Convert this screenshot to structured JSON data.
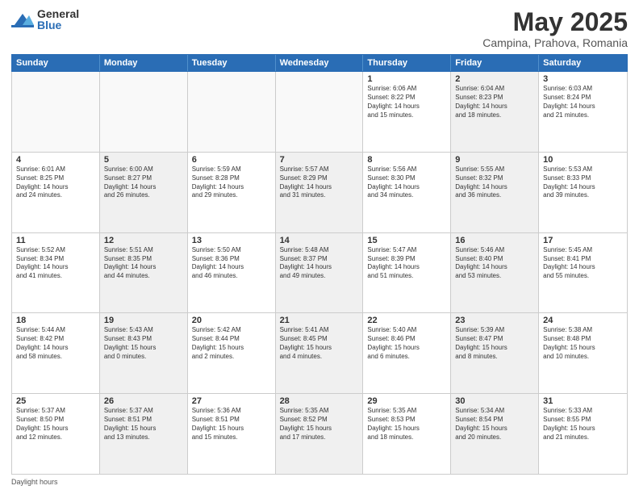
{
  "logo": {
    "general": "General",
    "blue": "Blue"
  },
  "title": "May 2025",
  "subtitle": "Campina, Prahova, Romania",
  "days": [
    "Sunday",
    "Monday",
    "Tuesday",
    "Wednesday",
    "Thursday",
    "Friday",
    "Saturday"
  ],
  "weeks": [
    [
      {
        "num": "",
        "text": "",
        "empty": true
      },
      {
        "num": "",
        "text": "",
        "empty": true
      },
      {
        "num": "",
        "text": "",
        "empty": true
      },
      {
        "num": "",
        "text": "",
        "empty": true
      },
      {
        "num": "1",
        "text": "Sunrise: 6:06 AM\nSunset: 8:22 PM\nDaylight: 14 hours\nand 15 minutes.",
        "empty": false
      },
      {
        "num": "2",
        "text": "Sunrise: 6:04 AM\nSunset: 8:23 PM\nDaylight: 14 hours\nand 18 minutes.",
        "empty": false,
        "shaded": true
      },
      {
        "num": "3",
        "text": "Sunrise: 6:03 AM\nSunset: 8:24 PM\nDaylight: 14 hours\nand 21 minutes.",
        "empty": false
      }
    ],
    [
      {
        "num": "4",
        "text": "Sunrise: 6:01 AM\nSunset: 8:25 PM\nDaylight: 14 hours\nand 24 minutes.",
        "empty": false
      },
      {
        "num": "5",
        "text": "Sunrise: 6:00 AM\nSunset: 8:27 PM\nDaylight: 14 hours\nand 26 minutes.",
        "empty": false,
        "shaded": true
      },
      {
        "num": "6",
        "text": "Sunrise: 5:59 AM\nSunset: 8:28 PM\nDaylight: 14 hours\nand 29 minutes.",
        "empty": false
      },
      {
        "num": "7",
        "text": "Sunrise: 5:57 AM\nSunset: 8:29 PM\nDaylight: 14 hours\nand 31 minutes.",
        "empty": false,
        "shaded": true
      },
      {
        "num": "8",
        "text": "Sunrise: 5:56 AM\nSunset: 8:30 PM\nDaylight: 14 hours\nand 34 minutes.",
        "empty": false
      },
      {
        "num": "9",
        "text": "Sunrise: 5:55 AM\nSunset: 8:32 PM\nDaylight: 14 hours\nand 36 minutes.",
        "empty": false,
        "shaded": true
      },
      {
        "num": "10",
        "text": "Sunrise: 5:53 AM\nSunset: 8:33 PM\nDaylight: 14 hours\nand 39 minutes.",
        "empty": false
      }
    ],
    [
      {
        "num": "11",
        "text": "Sunrise: 5:52 AM\nSunset: 8:34 PM\nDaylight: 14 hours\nand 41 minutes.",
        "empty": false
      },
      {
        "num": "12",
        "text": "Sunrise: 5:51 AM\nSunset: 8:35 PM\nDaylight: 14 hours\nand 44 minutes.",
        "empty": false,
        "shaded": true
      },
      {
        "num": "13",
        "text": "Sunrise: 5:50 AM\nSunset: 8:36 PM\nDaylight: 14 hours\nand 46 minutes.",
        "empty": false
      },
      {
        "num": "14",
        "text": "Sunrise: 5:48 AM\nSunset: 8:37 PM\nDaylight: 14 hours\nand 49 minutes.",
        "empty": false,
        "shaded": true
      },
      {
        "num": "15",
        "text": "Sunrise: 5:47 AM\nSunset: 8:39 PM\nDaylight: 14 hours\nand 51 minutes.",
        "empty": false
      },
      {
        "num": "16",
        "text": "Sunrise: 5:46 AM\nSunset: 8:40 PM\nDaylight: 14 hours\nand 53 minutes.",
        "empty": false,
        "shaded": true
      },
      {
        "num": "17",
        "text": "Sunrise: 5:45 AM\nSunset: 8:41 PM\nDaylight: 14 hours\nand 55 minutes.",
        "empty": false
      }
    ],
    [
      {
        "num": "18",
        "text": "Sunrise: 5:44 AM\nSunset: 8:42 PM\nDaylight: 14 hours\nand 58 minutes.",
        "empty": false
      },
      {
        "num": "19",
        "text": "Sunrise: 5:43 AM\nSunset: 8:43 PM\nDaylight: 15 hours\nand 0 minutes.",
        "empty": false,
        "shaded": true
      },
      {
        "num": "20",
        "text": "Sunrise: 5:42 AM\nSunset: 8:44 PM\nDaylight: 15 hours\nand 2 minutes.",
        "empty": false
      },
      {
        "num": "21",
        "text": "Sunrise: 5:41 AM\nSunset: 8:45 PM\nDaylight: 15 hours\nand 4 minutes.",
        "empty": false,
        "shaded": true
      },
      {
        "num": "22",
        "text": "Sunrise: 5:40 AM\nSunset: 8:46 PM\nDaylight: 15 hours\nand 6 minutes.",
        "empty": false
      },
      {
        "num": "23",
        "text": "Sunrise: 5:39 AM\nSunset: 8:47 PM\nDaylight: 15 hours\nand 8 minutes.",
        "empty": false,
        "shaded": true
      },
      {
        "num": "24",
        "text": "Sunrise: 5:38 AM\nSunset: 8:48 PM\nDaylight: 15 hours\nand 10 minutes.",
        "empty": false
      }
    ],
    [
      {
        "num": "25",
        "text": "Sunrise: 5:37 AM\nSunset: 8:50 PM\nDaylight: 15 hours\nand 12 minutes.",
        "empty": false
      },
      {
        "num": "26",
        "text": "Sunrise: 5:37 AM\nSunset: 8:51 PM\nDaylight: 15 hours\nand 13 minutes.",
        "empty": false,
        "shaded": true
      },
      {
        "num": "27",
        "text": "Sunrise: 5:36 AM\nSunset: 8:51 PM\nDaylight: 15 hours\nand 15 minutes.",
        "empty": false
      },
      {
        "num": "28",
        "text": "Sunrise: 5:35 AM\nSunset: 8:52 PM\nDaylight: 15 hours\nand 17 minutes.",
        "empty": false,
        "shaded": true
      },
      {
        "num": "29",
        "text": "Sunrise: 5:35 AM\nSunset: 8:53 PM\nDaylight: 15 hours\nand 18 minutes.",
        "empty": false
      },
      {
        "num": "30",
        "text": "Sunrise: 5:34 AM\nSunset: 8:54 PM\nDaylight: 15 hours\nand 20 minutes.",
        "empty": false,
        "shaded": true
      },
      {
        "num": "31",
        "text": "Sunrise: 5:33 AM\nSunset: 8:55 PM\nDaylight: 15 hours\nand 21 minutes.",
        "empty": false
      }
    ]
  ],
  "footer": "Daylight hours"
}
